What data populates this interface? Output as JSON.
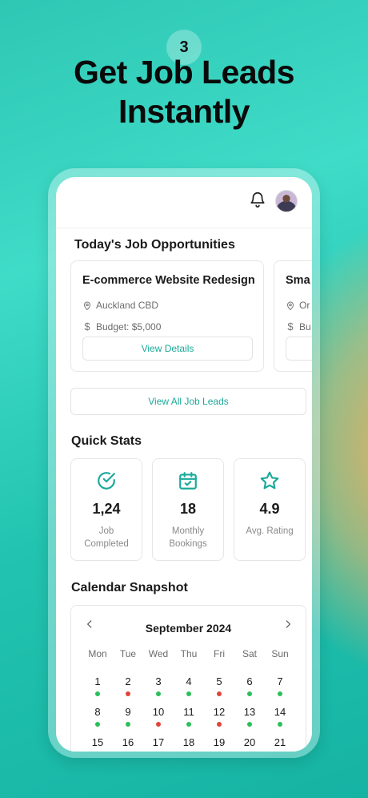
{
  "promo": {
    "step": "3",
    "headline_line1": "Get Job Leads",
    "headline_line2": "Instantly"
  },
  "app": {
    "today_title": "Today's Job Opportunities",
    "jobs": [
      {
        "title": "E-commerce Website Redesign",
        "location": "Auckland CBD",
        "budget": "Budget: $5,000",
        "button": "View Details"
      },
      {
        "title": "Sma",
        "location": "Or",
        "budget": "Bu",
        "button": ""
      }
    ],
    "view_all": "View All Job Leads",
    "quick_stats_title": "Quick Stats",
    "stats": [
      {
        "icon": "check-circle-icon",
        "value": "1,24",
        "label_line1": "Job",
        "label_line2": "Completed"
      },
      {
        "icon": "calendar-check-icon",
        "value": "18",
        "label_line1": "Monthly",
        "label_line2": "Bookings"
      },
      {
        "icon": "star-icon",
        "value": "4.9",
        "label_line1": "Avg. Rating",
        "label_line2": ""
      }
    ],
    "calendar_title": "Calendar Snapshot",
    "calendar": {
      "month": "September 2024",
      "weekdays": [
        "Mon",
        "Tue",
        "Wed",
        "Thu",
        "Fri",
        "Sat",
        "Sun"
      ],
      "weeks": [
        [
          {
            "d": "1",
            "s": "green"
          },
          {
            "d": "2",
            "s": "red"
          },
          {
            "d": "3",
            "s": "green"
          },
          {
            "d": "4",
            "s": "green"
          },
          {
            "d": "5",
            "s": "red"
          },
          {
            "d": "6",
            "s": "green"
          },
          {
            "d": "7",
            "s": "green"
          }
        ],
        [
          {
            "d": "8",
            "s": "green"
          },
          {
            "d": "9",
            "s": "green"
          },
          {
            "d": "10",
            "s": "red"
          },
          {
            "d": "11",
            "s": "green"
          },
          {
            "d": "12",
            "s": "red"
          },
          {
            "d": "13",
            "s": "green"
          },
          {
            "d": "14",
            "s": "green"
          }
        ],
        [
          {
            "d": "15",
            "s": ""
          },
          {
            "d": "16",
            "s": ""
          },
          {
            "d": "17",
            "s": ""
          },
          {
            "d": "18",
            "s": ""
          },
          {
            "d": "19",
            "s": ""
          },
          {
            "d": "20",
            "s": ""
          },
          {
            "d": "21",
            "s": ""
          }
        ]
      ]
    }
  },
  "colors": {
    "accent": "#1aa99a",
    "green": "#2bbf5c",
    "red": "#e0443a"
  }
}
